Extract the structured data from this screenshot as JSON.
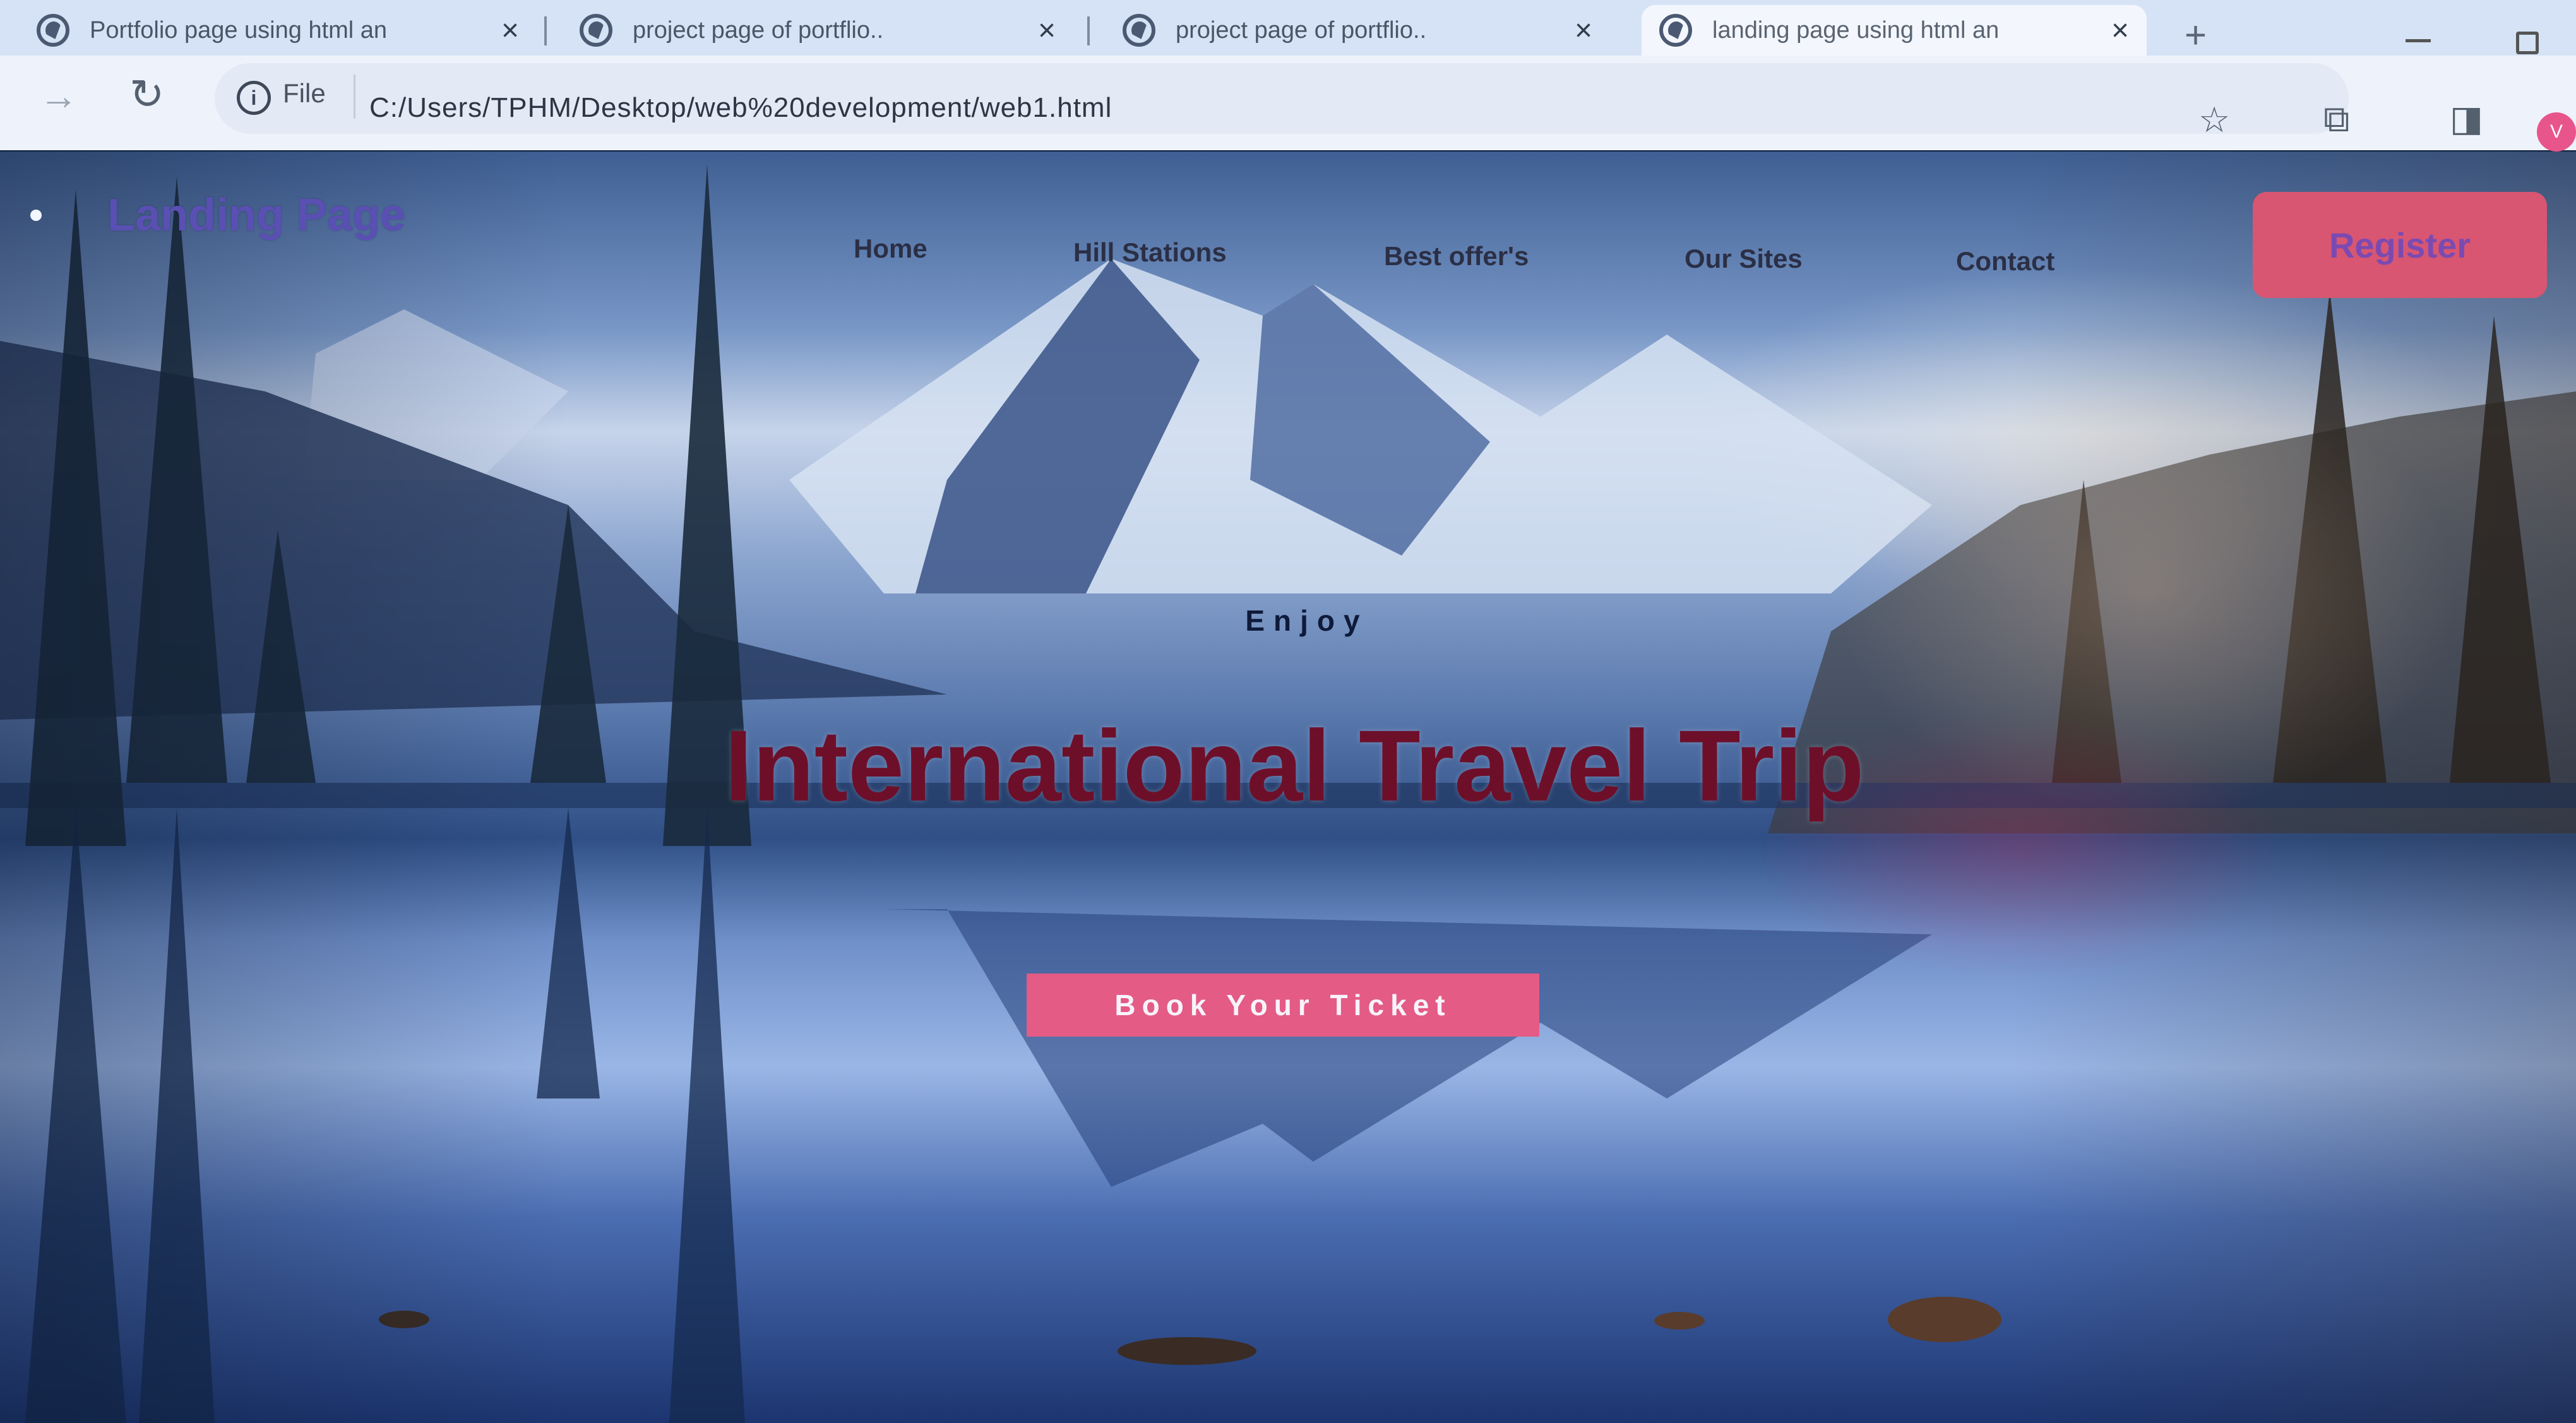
{
  "browser": {
    "tabs": [
      {
        "title": "Portfolio page using html an",
        "active": false
      },
      {
        "title": "project page of portflio..",
        "active": false
      },
      {
        "title": "project page of portflio..",
        "active": false
      },
      {
        "title": "landing page using html an",
        "active": true
      }
    ],
    "new_tab_icon": "plus-icon",
    "address_bar": {
      "scheme_label": "File",
      "url": "C:/Users/TPHM/Desktop/web%20development/web1.html"
    },
    "avatar_initial": "V"
  },
  "page": {
    "brand": "Landing Page",
    "nav": [
      {
        "label": "Home"
      },
      {
        "label": "Hill Stations"
      },
      {
        "label": "Best offer's"
      },
      {
        "label": "Our Sites"
      },
      {
        "label": "Contact"
      }
    ],
    "register_label": "Register",
    "hero": {
      "kicker": "Enjoy",
      "title": "International Travel Trip",
      "cta_label": "Book Your Ticket"
    }
  },
  "colors": {
    "brand_text": "#5a4fb3",
    "title_text": "#6e0f2a",
    "cta_background": "#e45b86",
    "register_background": "#d85671"
  }
}
